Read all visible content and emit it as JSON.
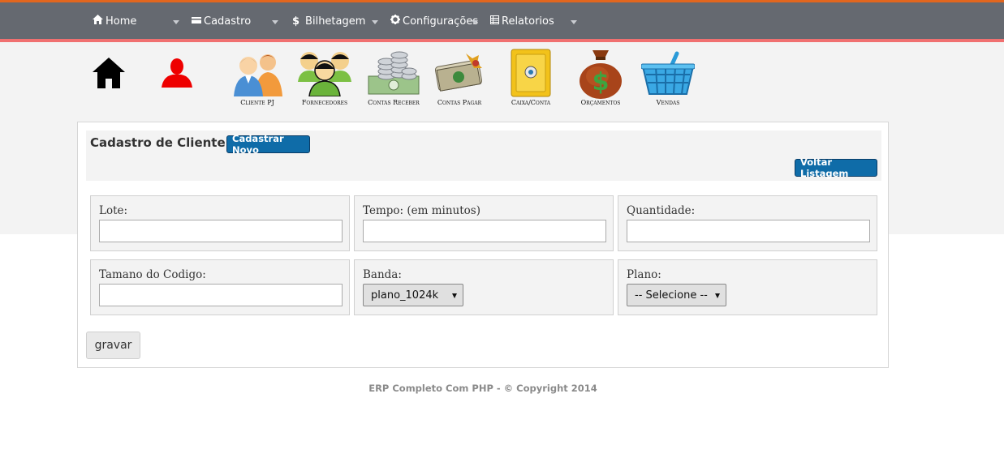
{
  "nav": {
    "items": [
      {
        "label": "Home",
        "icon": "home-icon"
      },
      {
        "label": "Cadastro",
        "icon": "card-icon"
      },
      {
        "label": "Bilhetagem",
        "icon": "dollar-icon"
      },
      {
        "label": "Configurações",
        "icon": "gear-icon"
      },
      {
        "label": "Relatorios",
        "icon": "table-icon"
      }
    ],
    "accent": "#e2661e",
    "background": "#656970"
  },
  "shortcuts": [
    {
      "label": "",
      "icon": "home-icon"
    },
    {
      "label": "",
      "icon": "user-icon"
    },
    {
      "label": "Cliente PJ",
      "icon": "clients-icon"
    },
    {
      "label": "Fornecedores",
      "icon": "suppliers-icon"
    },
    {
      "label": "Contas Receber",
      "icon": "coins-icon"
    },
    {
      "label": "Contas Pagar",
      "icon": "cash-icon"
    },
    {
      "label": "Caixa/Conta",
      "icon": "safe-icon"
    },
    {
      "label": "Orçamentos",
      "icon": "money-bag-icon"
    },
    {
      "label": "Vendas",
      "icon": "basket-icon"
    }
  ],
  "form": {
    "title": "Cadastro de Cliente:",
    "new_button": "Cadastrar Novo",
    "back_button": "Voltar Listagem",
    "fields": {
      "lote": {
        "label": "Lote:",
        "value": ""
      },
      "tempo": {
        "label": "Tempo: (em minutos)",
        "value": ""
      },
      "quantidade": {
        "label": "Quantidade:",
        "value": ""
      },
      "tamanho": {
        "label": "Tamano do Codigo:",
        "value": ""
      },
      "banda": {
        "label": "Banda:",
        "selected": "plano_1024k"
      },
      "plano": {
        "label": "Plano:",
        "selected": "-- Selecione --"
      }
    },
    "submit": "gravar"
  },
  "footer": {
    "text": "ERP Completo Com PHP - © Copyright 2014"
  }
}
